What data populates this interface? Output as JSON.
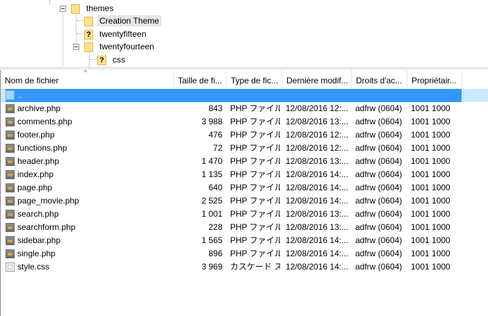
{
  "tree": {
    "nodes": [
      {
        "label": "themes",
        "type": "folder"
      },
      {
        "label": "Creation Theme",
        "type": "folder"
      },
      {
        "label": "twentyfifteen",
        "type": "unknown"
      },
      {
        "label": "twentyfourteen",
        "type": "folder"
      },
      {
        "label": "css",
        "type": "unknown"
      }
    ]
  },
  "list": {
    "columns": [
      "Nom de fichier",
      "Taille de fi...",
      "Type de fic...",
      "Dernière modif...",
      "Droits d'ac...",
      "Propriétair..."
    ],
    "sort_indicator": "^",
    "parent_row": "..",
    "rows": [
      {
        "name": "archive.php",
        "size": "843",
        "type": "PHP ファイル",
        "modified": "12/08/2016 12:...",
        "rights": "adfrw (0604)",
        "owner": "1001 1000"
      },
      {
        "name": "comments.php",
        "size": "3 988",
        "type": "PHP ファイル",
        "modified": "12/08/2016 13:...",
        "rights": "adfrw (0604)",
        "owner": "1001 1000"
      },
      {
        "name": "footer.php",
        "size": "476",
        "type": "PHP ファイル",
        "modified": "12/08/2016 12:...",
        "rights": "adfrw (0604)",
        "owner": "1001 1000"
      },
      {
        "name": "functions.php",
        "size": "72",
        "type": "PHP ファイル",
        "modified": "12/08/2016 12:...",
        "rights": "adfrw (0604)",
        "owner": "1001 1000"
      },
      {
        "name": "header.php",
        "size": "1 470",
        "type": "PHP ファイル",
        "modified": "12/08/2016 13:...",
        "rights": "adfrw (0604)",
        "owner": "1001 1000"
      },
      {
        "name": "index.php",
        "size": "1 135",
        "type": "PHP ファイル",
        "modified": "12/08/2016 14:...",
        "rights": "adfrw (0604)",
        "owner": "1001 1000"
      },
      {
        "name": "page.php",
        "size": "640",
        "type": "PHP ファイル",
        "modified": "12/08/2016 14:...",
        "rights": "adfrw (0604)",
        "owner": "1001 1000"
      },
      {
        "name": "page_movie.php",
        "size": "2 525",
        "type": "PHP ファイル",
        "modified": "12/08/2016 14:...",
        "rights": "adfrw (0604)",
        "owner": "1001 1000"
      },
      {
        "name": "search.php",
        "size": "1 001",
        "type": "PHP ファイル",
        "modified": "12/08/2016 13:...",
        "rights": "adfrw (0604)",
        "owner": "1001 1000"
      },
      {
        "name": "searchform.php",
        "size": "228",
        "type": "PHP ファイル",
        "modified": "12/08/2016 13:...",
        "rights": "adfrw (0604)",
        "owner": "1001 1000"
      },
      {
        "name": "sidebar.php",
        "size": "1 565",
        "type": "PHP ファイル",
        "modified": "12/08/2016 14:...",
        "rights": "adfrw (0604)",
        "owner": "1001 1000"
      },
      {
        "name": "single.php",
        "size": "896",
        "type": "PHP ファイル",
        "modified": "12/08/2016 14:...",
        "rights": "adfrw (0604)",
        "owner": "1001 1000"
      },
      {
        "name": "style.css",
        "size": "3 969",
        "type": "カスケード ス...",
        "modified": "12/08/2016 14:...",
        "rights": "adfrw (0604)",
        "owner": "1001 1000"
      }
    ]
  },
  "colors": {
    "selection": "#3399ff",
    "folder": "#fde38a"
  }
}
